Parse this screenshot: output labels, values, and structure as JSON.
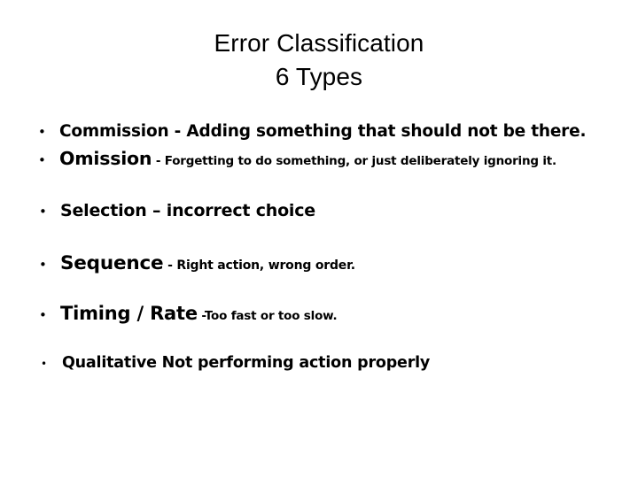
{
  "slide": {
    "background_color": "#ffffff",
    "text_color": "#000000",
    "title": {
      "line1": "Error Classification",
      "line2": "6 Types"
    },
    "bullet_glyph": "•",
    "items": [
      {
        "term": "Commission",
        "separator": " -  ",
        "description": "Adding something that should not be there."
      },
      {
        "term": "Omission",
        "separator": " - ",
        "description": "Forgetting  to do something, or just deliberately ignoring it."
      },
      {
        "term": "Selection",
        "separator": " – ",
        "description": "incorrect choice"
      },
      {
        "term": "Sequence",
        "separator": " - ",
        "description": "Right action, wrong order."
      },
      {
        "term": "Timing / Rate",
        "separator": " -",
        "description": "Too fast or too slow."
      },
      {
        "term": "Qualitative",
        "separator": "  ",
        "description": "Not performing action properly"
      }
    ]
  }
}
